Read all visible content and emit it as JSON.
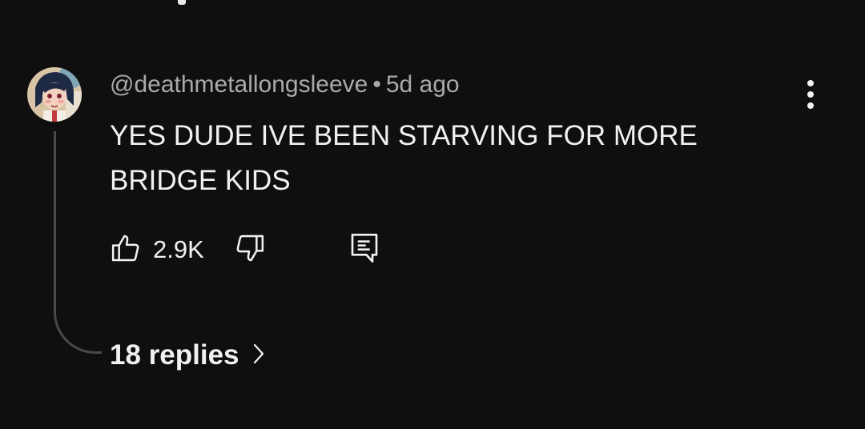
{
  "comment": {
    "author": "@deathmetallongsleeve",
    "separator": "•",
    "time": "5d ago",
    "text": "YES DUDE IVE BEEN STARVING FOR MORE\nBRIDGE KIDS",
    "likes": "2.9K",
    "replies_label": "18 replies"
  },
  "icons": {
    "more": "vertical-ellipsis-icon",
    "like": "thumbs-up-icon",
    "dislike": "thumbs-down-icon",
    "reply": "comment-reply-icon",
    "replies": "chevron-right-icon"
  },
  "colors": {
    "background": "#0f0f0f",
    "text": "#f1f1f1",
    "meta": "#aaaaaa",
    "thread": "#4a4a4a"
  }
}
